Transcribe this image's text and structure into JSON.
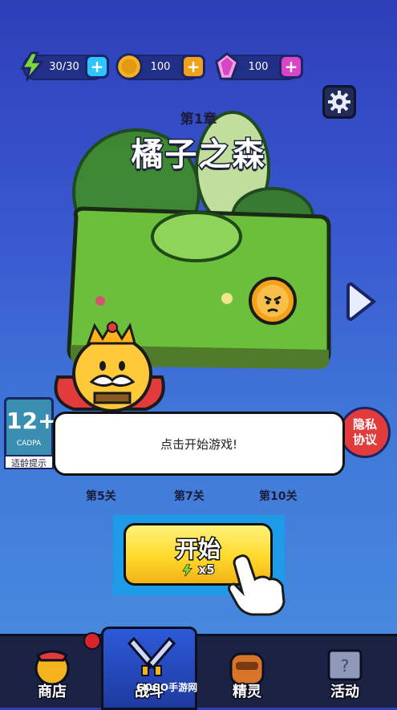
{
  "resources": [
    {
      "icon": "energy-icon",
      "value": "30/30",
      "color": "#2ec4ff"
    },
    {
      "icon": "coin-icon",
      "value": "100",
      "color": "#f0a21c"
    },
    {
      "icon": "gem-icon",
      "value": "100",
      "color": "#d845c8"
    }
  ],
  "chapter": {
    "subtitle": "第1章",
    "title": "橘子之森"
  },
  "age_rating": {
    "number": "12+",
    "org": "CADPA",
    "tip": "适龄提示"
  },
  "privacy": {
    "line1": "隐私",
    "line2": "协议"
  },
  "dialog": {
    "text": "点击开始游戏!"
  },
  "levels": [
    "第5关",
    "第7关",
    "第10关"
  ],
  "start": {
    "label": "开始",
    "cost": "x5"
  },
  "nav": [
    {
      "label": "商店",
      "icon": "shop-icon"
    },
    {
      "label": "战斗",
      "icon": "battle-swords-icon"
    },
    {
      "label": "精灵",
      "icon": "sprite-icon"
    },
    {
      "label": "活动",
      "icon": "event-icon"
    }
  ],
  "watermark": "GOGO手游网",
  "colors": {
    "accent": "#ffd92b",
    "privacy": "#e23b3b",
    "grass": "#6bbf3a"
  }
}
